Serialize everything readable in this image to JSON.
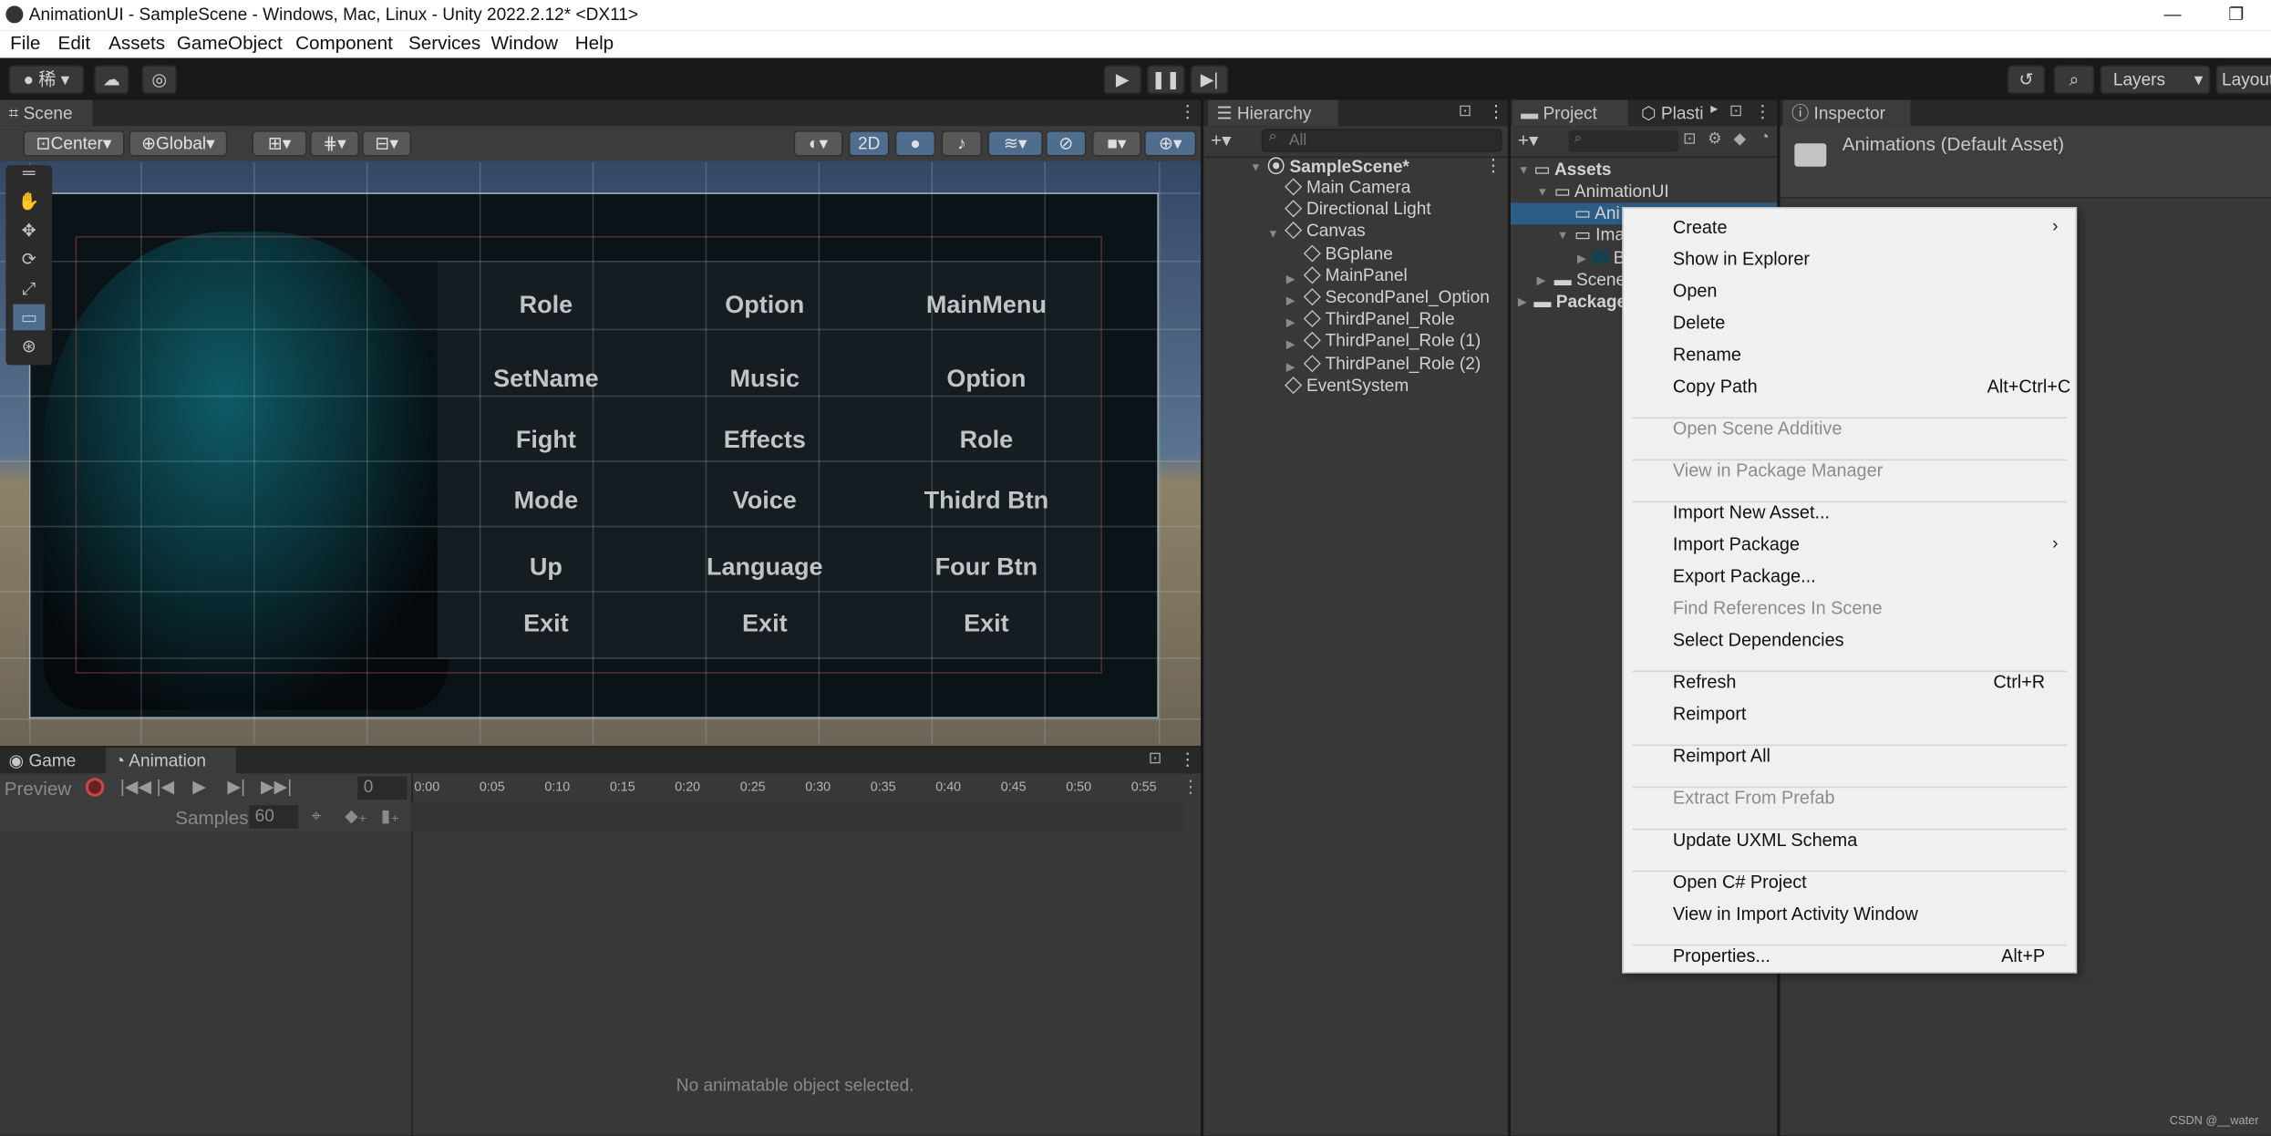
{
  "window": {
    "title": "AnimationUI - SampleScene - Windows, Mac, Linux - Unity 2022.2.12* <DX11>",
    "minimize": "—",
    "restore": "❐"
  },
  "menu": [
    "File",
    "Edit",
    "Assets",
    "GameObject",
    "Component",
    "Services",
    "Window",
    "Help"
  ],
  "toolbar": {
    "account_icon": "account-icon",
    "cloud_icon": "cloud-icon",
    "play_icon": "play-icon",
    "pause_icon": "pause-icon",
    "step_icon": "step-icon",
    "layers": "Layers",
    "layout": "Layout"
  },
  "scene": {
    "tab": "Scene",
    "center": "Center",
    "global": "Global",
    "mode2d": "2D",
    "buttons": [
      [
        "Role",
        "Option",
        "MainMenu"
      ],
      [
        "SetName",
        "Music",
        "Option"
      ],
      [
        "Fight",
        "Effects",
        "Role"
      ],
      [
        "Mode",
        "Voice",
        "Thidrd Btn"
      ],
      [
        "Up",
        "Language",
        "Four Btn"
      ],
      [
        "Exit",
        "Exit",
        "Exit"
      ]
    ]
  },
  "bottom": {
    "tab_game": "Game",
    "tab_animation": "Animation",
    "preview": "Preview",
    "frame": "0",
    "samples_label": "Samples",
    "samples_value": "60",
    "no_object": "No animatable object selected.",
    "timeline": [
      "0:00",
      "0:05",
      "0:10",
      "0:15",
      "0:20",
      "0:25",
      "0:30",
      "0:35",
      "0:40",
      "0:45",
      "0:50",
      "0:55"
    ]
  },
  "hierarchy": {
    "tab": "Hierarchy",
    "search_placeholder": "All",
    "scene": "SampleScene*",
    "items": [
      {
        "label": "Main Camera",
        "indent": 1,
        "arrow": false
      },
      {
        "label": "Directional Light",
        "indent": 1,
        "arrow": false
      },
      {
        "label": "Canvas",
        "indent": 1,
        "arrow": true
      },
      {
        "label": "BGplane",
        "indent": 2,
        "arrow": false
      },
      {
        "label": "MainPanel",
        "indent": 2,
        "arrow": true
      },
      {
        "label": "SecondPanel_Option",
        "indent": 2,
        "arrow": true
      },
      {
        "label": "ThirdPanel_Role",
        "indent": 2,
        "arrow": true
      },
      {
        "label": "ThirdPanel_Role (1)",
        "indent": 2,
        "arrow": true
      },
      {
        "label": "ThirdPanel_Role (2)",
        "indent": 2,
        "arrow": true
      },
      {
        "label": "EventSystem",
        "indent": 1,
        "arrow": false
      }
    ]
  },
  "project": {
    "tab": "Project",
    "tab2": "Plasti",
    "tree": [
      "Assets",
      "AnimationUI",
      "Ani",
      "Ima",
      "B",
      "Scene",
      "Package"
    ]
  },
  "inspector": {
    "tab": "Inspector",
    "title": "Animations (Default Asset)"
  },
  "context_menu": [
    {
      "label": "Create",
      "submenu": true
    },
    {
      "label": "Show in Explorer"
    },
    {
      "label": "Open"
    },
    {
      "label": "Delete"
    },
    {
      "label": "Rename"
    },
    {
      "label": "Copy Path",
      "shortcut": "Alt+Ctrl+C"
    },
    {
      "sep": true
    },
    {
      "label": "Open Scene Additive",
      "disabled": true
    },
    {
      "sep": true
    },
    {
      "label": "View in Package Manager",
      "disabled": true
    },
    {
      "sep": true
    },
    {
      "label": "Import New Asset..."
    },
    {
      "label": "Import Package",
      "submenu": true
    },
    {
      "label": "Export Package..."
    },
    {
      "label": "Find References In Scene",
      "disabled": true
    },
    {
      "label": "Select Dependencies"
    },
    {
      "sep": true
    },
    {
      "label": "Refresh",
      "shortcut": "Ctrl+R"
    },
    {
      "label": "Reimport"
    },
    {
      "sep": true
    },
    {
      "label": "Reimport All"
    },
    {
      "sep": true
    },
    {
      "label": "Extract From Prefab",
      "disabled": true
    },
    {
      "sep": true
    },
    {
      "label": "Update UXML Schema"
    },
    {
      "sep": true
    },
    {
      "label": "Open C# Project"
    },
    {
      "label": "View in Import Activity Window"
    },
    {
      "sep": true
    },
    {
      "label": "Properties...",
      "shortcut": "Alt+P"
    }
  ],
  "watermark": "CSDN @__water"
}
